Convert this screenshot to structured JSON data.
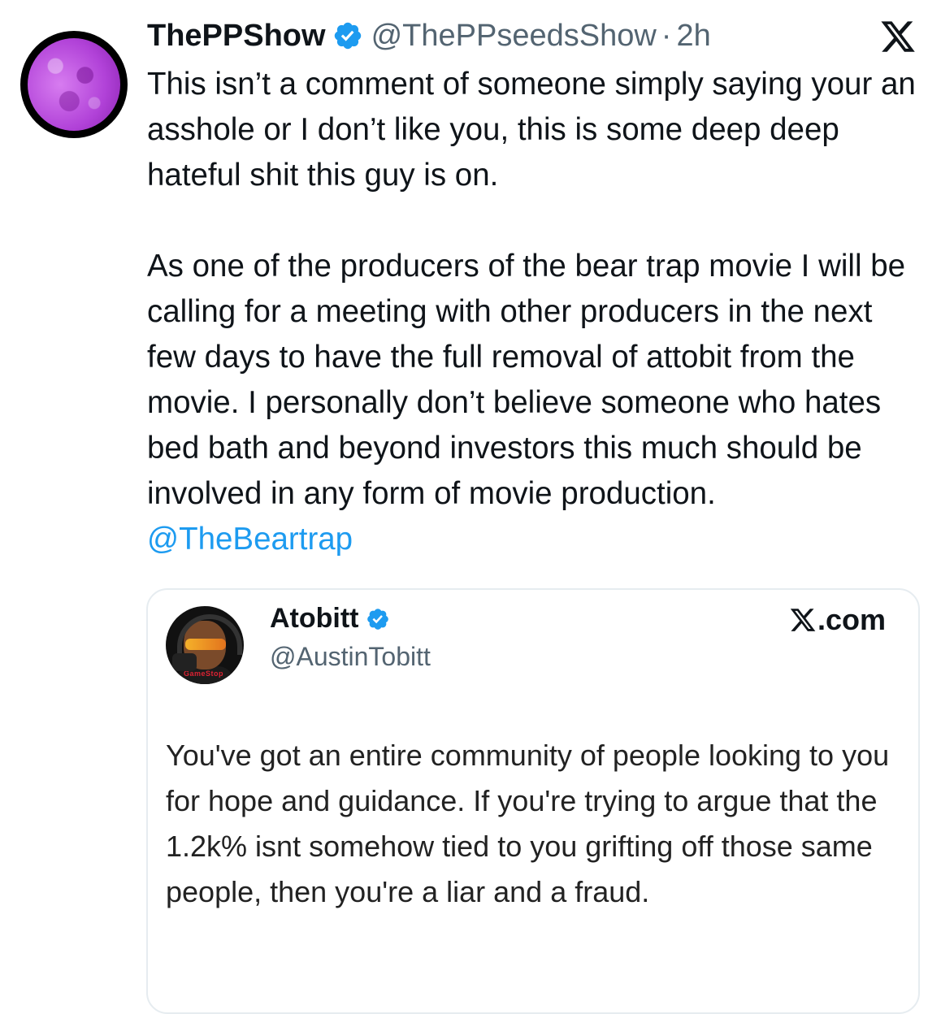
{
  "tweet": {
    "display_name": "ThePPShow",
    "handle": "@ThePPseedsShow",
    "separator": "·",
    "time": "2h",
    "paragraph_1": "This isn’t a comment of someone simply saying your an asshole or I don’t like you, this is some deep deep hateful shit this guy is on.",
    "paragraph_2": "As one of the producers of the bear trap movie I will be calling for a meeting with other producers in the next few days to have the full removal of attobit from the movie. I personally don’t believe someone who hates bed bath and beyond investors this much should be involved in any form of movie production.",
    "mention": "@TheBeartrap"
  },
  "quote": {
    "display_name": "Atobitt",
    "handle": "@AustinTobitt",
    "source_label": ".com",
    "avatar_shirt_text": "GameStop",
    "text": "You've got an entire community of people looking to you for hope and guidance. If you're trying to argue that the 1.2k% isnt somehow tied to you grifting off those same people, then you're a liar and a fraud."
  },
  "colors": {
    "accent": "#1d9bf0",
    "text": "#0f1419",
    "muted": "#536471",
    "border": "#e6ecf0"
  },
  "icons": {
    "verified": "verified-badge-icon",
    "platform": "x-logo-icon"
  }
}
